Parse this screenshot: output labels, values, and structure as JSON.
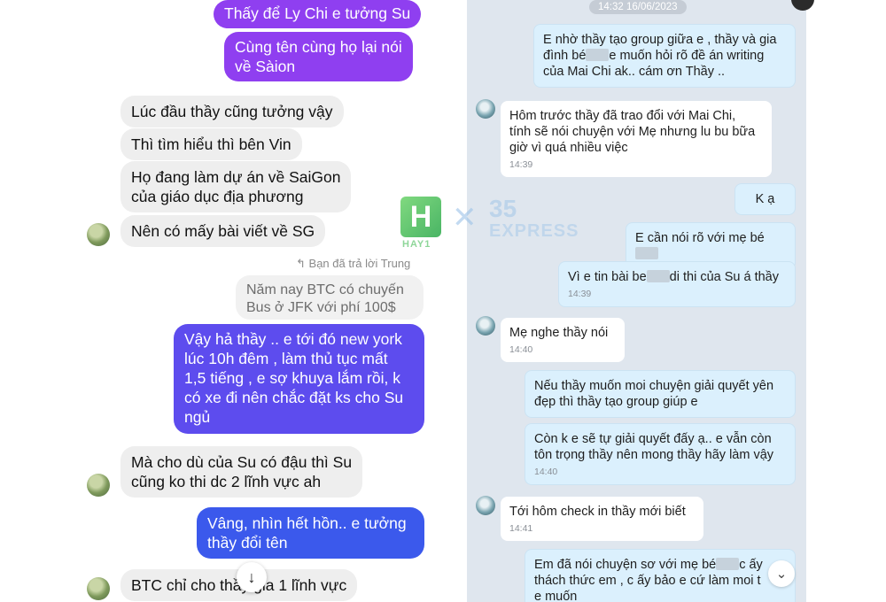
{
  "left": {
    "messages": [
      {
        "side": "out",
        "text": "Thấy để Ly Chi e tưởng Su"
      },
      {
        "side": "out",
        "line1": "Cùng tên cùng họ lại nói",
        "line2": "về Sàion"
      },
      {
        "side": "in",
        "text": "Lúc đầu thầy cũng tưởng vậy"
      },
      {
        "side": "in",
        "text": "Thì tìm hiểu thì bên Vin"
      },
      {
        "side": "in",
        "line1": "Họ đang làm dự án về SaiGon",
        "line2": "của giáo dục địa phương"
      },
      {
        "side": "in",
        "text": "Nên có mấy bài viết về SG"
      },
      {
        "side": "in",
        "line1": "Mà cho dù của Su có đậu thì Su",
        "line2": "cũng ko thi dc 2 lĩnh vực ah"
      },
      {
        "side": "out",
        "line1": "Vâng, nhìn hết hồn.. e tưởng",
        "line2": "thầy đổi tên"
      },
      {
        "side": "in",
        "text": "BTC chỉ cho thầy gia 1 lĩnh vực"
      }
    ],
    "reply_note": "Bạn đã trả lời Trung",
    "quote": {
      "line1": "Năm nay BTC có chuyến",
      "line2": "Bus ở JFK với phí 100$"
    },
    "long_reply": {
      "line1": "Vậy hả thầy .. e tới đó new york",
      "line2": "lúc 10h đêm , làm thủ tục mất",
      "line3": "1,5 tiếng , e sợ khuya lắm rồi, k",
      "line4": "có xe đi nên chắc đặt ks cho Su",
      "line5": "ngủ"
    },
    "scroll_icon": "↓"
  },
  "right": {
    "timestamp": "14:32 16/06/2023",
    "m1": {
      "l1": "E nhờ thầy tạo group giữa e , thầy và gia",
      "l2a": "đình bé",
      "l2b": "e muốn hỏi rõ đề án writing",
      "l3": "của Mai Chi ak.. cám ơn Thầy .."
    },
    "m2": {
      "l1": "Hôm trước thầy đã trao đổi với Mai Chi,",
      "l2": "tính sẽ nói chuyện với Mẹ nhưng lu bu bữa",
      "l3": "giờ vì quá nhiều việc",
      "time": "14:39"
    },
    "m3": {
      "text": "K ạ"
    },
    "m4": {
      "text": "E cần nói rõ với mẹ bé"
    },
    "m5": {
      "a": "Vì e tin bài be",
      "b": "di thi của Su á thầy",
      "time": "14:39"
    },
    "m6": {
      "text": "Mẹ nghe thầy nói",
      "time": "14:40"
    },
    "m7": {
      "l1": "Nếu thầy muốn moi chuyện giải quyết yên",
      "l2": "đẹp thì thầy tạo group giúp e"
    },
    "m8": {
      "l1": "Còn k e sẽ tự giải quyết đấy ạ.. e vẫn còn",
      "l2": "tôn trọng thầy nên mong thầy hãy làm vậy",
      "time": "14:40"
    },
    "m9": {
      "text": "Tới hôm check in thầy mới biết",
      "time": "14:41"
    },
    "m10": {
      "l1a": "Em đã nói chuyện sơ với mẹ bé",
      "l1b": "c ấy",
      "l2": "thách thức em , c ấy bảo e cứ làm moi t",
      "l3": "e muốn"
    },
    "scroll_icon": "⌄"
  },
  "watermark": {
    "logo_letter": "H",
    "logo_sub": "HAY1",
    "times": "✕",
    "num": "35",
    "brand": "EXPRESS"
  }
}
